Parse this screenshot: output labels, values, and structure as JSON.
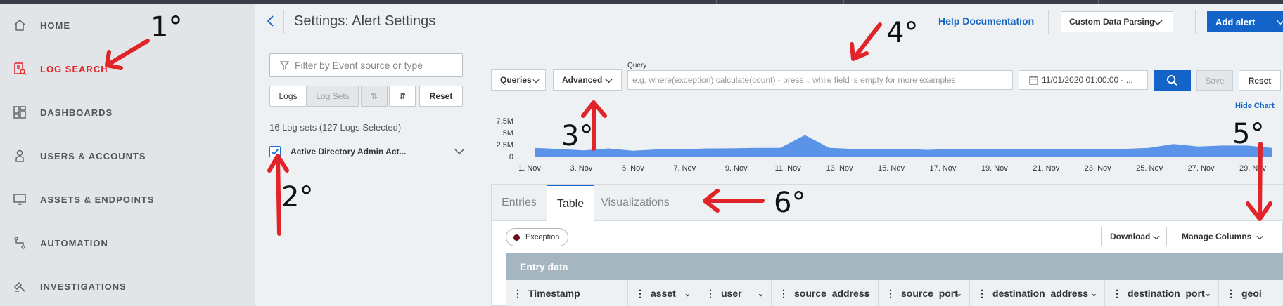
{
  "nav": {
    "items": [
      {
        "label": "HOME",
        "icon": "home-icon"
      },
      {
        "label": "LOG SEARCH",
        "icon": "log-search-icon",
        "active": true
      },
      {
        "label": "DASHBOARDS",
        "icon": "dashboards-icon"
      },
      {
        "label": "USERS & ACCOUNTS",
        "icon": "user-icon"
      },
      {
        "label": "ASSETS & ENDPOINTS",
        "icon": "monitor-icon"
      },
      {
        "label": "AUTOMATION",
        "icon": "automation-icon"
      },
      {
        "label": "INVESTIGATIONS",
        "icon": "investigations-icon"
      }
    ],
    "active_color": "#e0242a"
  },
  "header": {
    "title": "Settings: Alert Settings",
    "help_label": "Help Documentation",
    "custom_parsing_label": "Custom Data Parsing",
    "add_alert_label": "Add alert"
  },
  "filters": {
    "placeholder": "Filter by Event source or type",
    "logs_label": "Logs",
    "logsets_label": "Log Sets",
    "reset_label": "Reset",
    "count_text": "16 Log sets (127 Logs Selected)",
    "logset_name": "Active Directory Admin Act...",
    "logset_checked": true
  },
  "query": {
    "queries_label": "Queries",
    "mode_label": "Advanced",
    "label": "Query",
    "placeholder": "e.g. where(exception) calculate(count) - press ↓ while field is empty for more examples",
    "date_value": "11/01/2020 01:00:00 - ...",
    "save_label": "Save",
    "reset_label": "Reset",
    "hide_chart_label": "Hide Chart"
  },
  "chart_data": {
    "type": "area",
    "y_ticks": [
      "7.5M",
      "5M",
      "2.5M",
      "0"
    ],
    "x_ticks": [
      "1. Nov",
      "3. Nov",
      "5. Nov",
      "7. Nov",
      "9. Nov",
      "11. Nov",
      "13. Nov",
      "15. Nov",
      "17. Nov",
      "19. Nov",
      "21. Nov",
      "23. Nov",
      "25. Nov",
      "27. Nov",
      "29. Nov"
    ],
    "ylim": [
      0,
      7500000
    ],
    "color": "#5b93e8",
    "series": [
      {
        "values": [
          1800000,
          1500000,
          1300000,
          1600000,
          1200000,
          1400000,
          1500000,
          1600000,
          1700000,
          1700000,
          1800000,
          4400000,
          1800000,
          1500000,
          1500000,
          1500000,
          1400000,
          1500000,
          1600000,
          1500000,
          1500000,
          1400000,
          1500000,
          1500000,
          1600000,
          1700000,
          2600000,
          2000000,
          2300000,
          2200000,
          1800000
        ]
      }
    ]
  },
  "tabs": {
    "items": [
      "Entries",
      "Table",
      "Visualizations"
    ],
    "active": 1
  },
  "table": {
    "chip_label": "Exception",
    "download_label": "Download",
    "manage_columns_label": "Manage Columns",
    "entry_data_label": "Entry data",
    "columns": [
      "Timestamp",
      "asset",
      "user",
      "source_address",
      "source_port",
      "destination_address",
      "destination_port",
      "geoi"
    ]
  },
  "annotations": {
    "numbers": [
      "1°",
      "2°",
      "3°",
      "4°",
      "5°",
      "6°"
    ],
    "color": "#e0242a"
  }
}
